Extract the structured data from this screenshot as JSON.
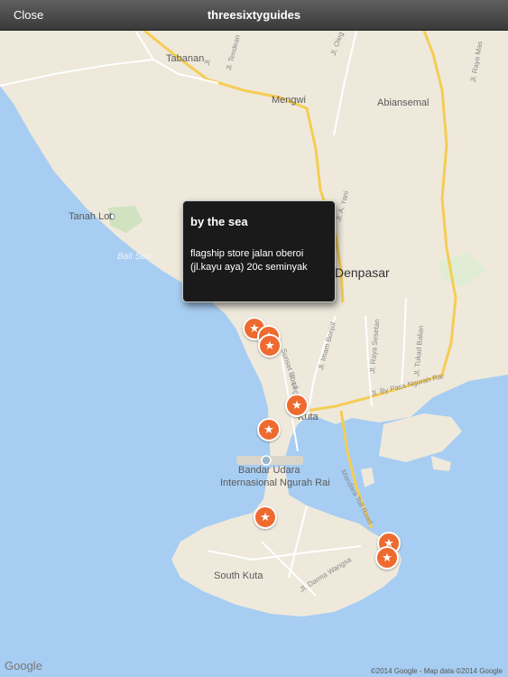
{
  "navbar": {
    "close_label": "Close",
    "title": "threesixtyguides"
  },
  "map": {
    "places": {
      "tabanan": "Tabanan",
      "mengwi": "Mengwi",
      "abiansemal": "Abiansemal",
      "tanah_lot": "Tanah Lot",
      "bali_sea": "Bali Sea",
      "denpasar": "Denpasar",
      "kuta": "Kuta",
      "airport_line1": "Bandar Udara",
      "airport_line2": "Internasional Ngurah Rai",
      "south_kuta": "South Kuta"
    },
    "roads": {
      "jl_tendean": "Jl. Tendean",
      "jl_oleg": "Jl. Oleg",
      "jl_raya_mas": "Jl. Raya Mas",
      "jl_a_yani": "Jl. A. Yani",
      "sunset_road": "Sunset Road",
      "jl_imam_bonjol": "Jl. Imam Bonjol",
      "jl_raya_sesetan": "Jl. Raya Sesetan",
      "jl_tukad_balian": "Jl. Tukad Balian",
      "jl_by_pass": "Jl. By Pass Ngurah Rai",
      "jl_legian": "Jl. Legian",
      "mandara_toll": "Mandara Toll Road",
      "jl_darma_wangsa": "Jl. Darma Wangsa",
      "jl_short": "Jl."
    },
    "marker_icon": "star-icon",
    "colors": {
      "sea": "#a7cdf2",
      "land": "#efe9dc",
      "marker": "#ee6a2f",
      "major_road": "#f5cd54"
    }
  },
  "callout": {
    "title": "by the sea",
    "body": "flagship store jalan oberoi (jl.kayu aya) 20c seminyak"
  },
  "footer": {
    "logo": "Google",
    "attribution": "©2014 Google - Map data ©2014 Google"
  }
}
